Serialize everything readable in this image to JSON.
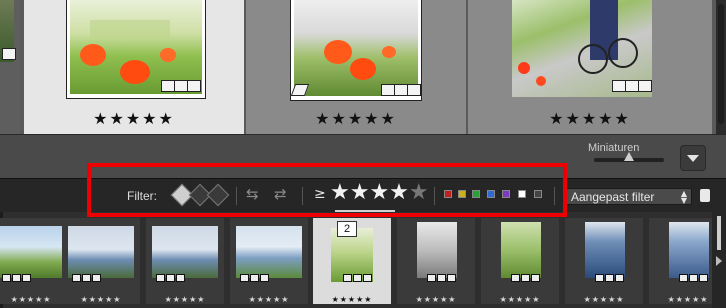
{
  "grid": {
    "cells": [
      {
        "id": "cell-partial-left",
        "rating": "",
        "photo": "field"
      },
      {
        "id": "cell-1",
        "rating": "★★★★★",
        "photo": "poppies"
      },
      {
        "id": "cell-2",
        "rating": "★★★★★",
        "photo": "poppies-bw"
      },
      {
        "id": "cell-3",
        "rating": "★★★★★",
        "photo": "bikes"
      }
    ]
  },
  "toolbar": {
    "thumbnail_label": "Miniaturen",
    "thumbnail_size": 0.5
  },
  "filterbar": {
    "label": "Filter:",
    "rating_operator": "≥",
    "rating_filled": "★★★★",
    "rating_empty": "★",
    "rating_value": 4,
    "color_labels": [
      "#c21f1f",
      "#c9b21c",
      "#27a33a",
      "#2e6ad1",
      "#7b3bbf",
      "#ffffff",
      "#444444"
    ],
    "preset": "Aangepast filter"
  },
  "filmstrip": {
    "selected_number": "2",
    "items": [
      {
        "rating": "★★★★★",
        "photo": "field"
      },
      {
        "rating": "★★★★★",
        "photo": "canal-man"
      },
      {
        "rating": "★★★★★",
        "photo": "canal-man"
      },
      {
        "rating": "★★★★★",
        "photo": "canal-bikes"
      },
      {
        "rating": "★★★★★",
        "photo": "poppies"
      },
      {
        "rating": "★★★★★",
        "photo": "cyclist-bw"
      },
      {
        "rating": "★★★★★",
        "photo": "cyclist-field"
      },
      {
        "rating": "★★★★★",
        "photo": "poster"
      },
      {
        "rating": "★★★★★",
        "photo": "poster2"
      }
    ]
  }
}
